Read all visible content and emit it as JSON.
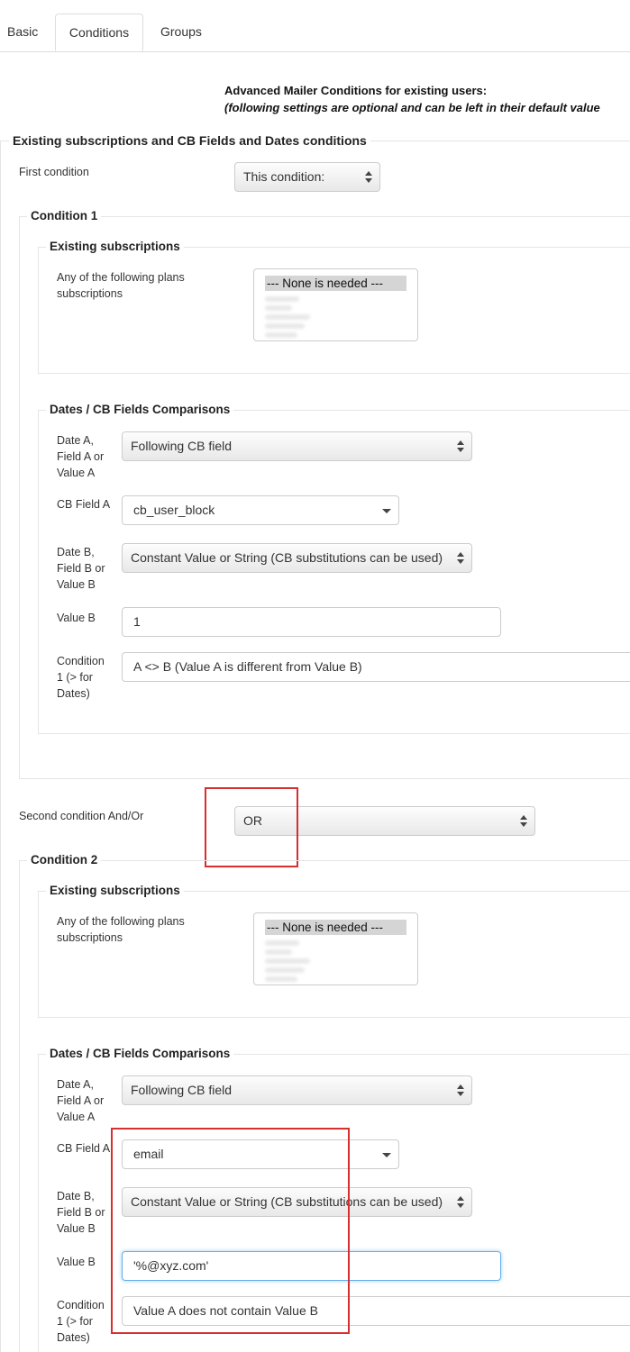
{
  "tabs": [
    "Basic",
    "Conditions",
    "Groups"
  ],
  "intro": {
    "title": "Advanced Mailer Conditions for existing users:",
    "subtitle": "(following settings are optional and can be left in their default value"
  },
  "main_legend": "Existing subscriptions and CB Fields and Dates conditions",
  "first_condition": {
    "label": "First condition",
    "value": "This condition:"
  },
  "second_condition": {
    "label": "Second condition And/Or",
    "value": "OR"
  },
  "conditions": [
    {
      "legend": "Condition 1",
      "subs_legend": "Existing subscriptions",
      "plans_label": "Any of the following plans subscriptions",
      "plans_selected": "--- None is needed ---",
      "dates_legend": "Dates / CB Fields Comparisons",
      "date_a_label": "Date A, Field A or Value A",
      "date_a_value": "Following CB field",
      "cb_field_label": "CB Field A",
      "cb_field_value": "cb_user_block",
      "date_b_label": "Date B, Field B or Value B",
      "date_b_value": "Constant Value or String (CB substitutions can be used)",
      "value_b_label": "Value B",
      "value_b_value": "1",
      "cond_label": "Condition 1 (> for Dates)",
      "cond_value": "A <> B (Value A is different from Value B)"
    },
    {
      "legend": "Condition 2",
      "subs_legend": "Existing subscriptions",
      "plans_label": "Any of the following plans subscriptions",
      "plans_selected": "--- None is needed ---",
      "dates_legend": "Dates / CB Fields Comparisons",
      "date_a_label": "Date A, Field A or Value A",
      "date_a_value": "Following CB field",
      "cb_field_label": "CB Field A",
      "cb_field_value": "email",
      "date_b_label": "Date B, Field B or Value B",
      "date_b_value": "Constant Value or String (CB substitutions can be used)",
      "value_b_label": "Value B",
      "value_b_value": "'%@xyz.com'",
      "cond_label": "Condition 1 (> for Dates)",
      "cond_value": "Value A does not contain Value B"
    }
  ],
  "colors": {
    "highlight_box": "#d62f2f",
    "focus_border": "#66afe9"
  }
}
